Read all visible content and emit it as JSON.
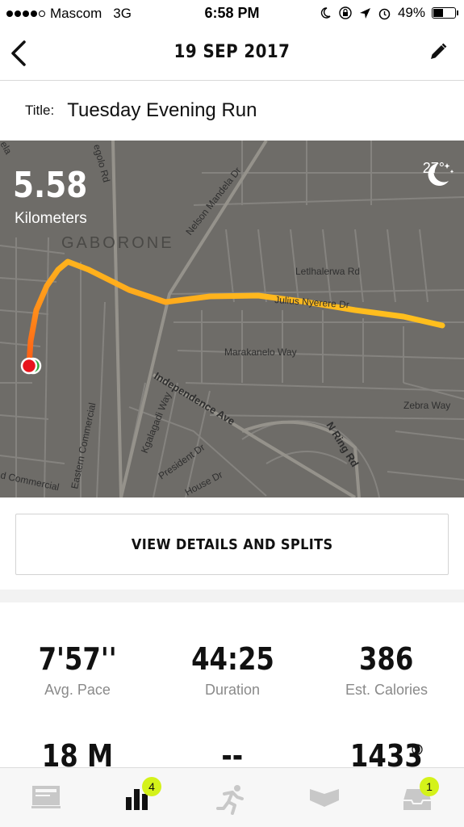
{
  "status_bar": {
    "carrier": "Mascom",
    "network": "3G",
    "time": "6:58 PM",
    "battery_percent": "49%",
    "battery_level": 0.49
  },
  "header": {
    "title": "19 SEP 2017",
    "back_icon": "chevron-left-icon",
    "edit_icon": "pencil-icon"
  },
  "run_title": {
    "label": "Title:",
    "value": "Tuesday Evening Run"
  },
  "map": {
    "distance": "5.58",
    "distance_unit": "Kilometers",
    "temperature": "27°",
    "weather_icon": "moon-stars-icon",
    "labels": {
      "city": "GABORONE",
      "nelson": "Nelson Mandela Dr",
      "letlhalerwa": "Letlhalerwa Rd",
      "julius": "Julius Nyerere Dr",
      "marakanelo": "Marakanelo Way",
      "independence": "Independence Ave",
      "nring": "N Ring Rd",
      "zebra": "Zebra Way",
      "kgalagadi": "Kgalagadi Way",
      "president": "President Dr",
      "house": "House Dr",
      "eastern": "Eastern Commercial",
      "commercial": "d Commercial",
      "segolo": "egolo Rd",
      "ela": "ela"
    },
    "route_colors": [
      "#ff6a1a",
      "#ffb21a",
      "#ffd21a"
    ]
  },
  "details_button": {
    "label": "VIEW DETAILS AND SPLITS"
  },
  "stats": [
    {
      "value": "7'57''",
      "label": "Avg. Pace"
    },
    {
      "value": "44:25",
      "label": "Duration"
    },
    {
      "value": "386",
      "label": "Est. Calories"
    },
    {
      "value": "18 M",
      "label": ""
    },
    {
      "value": "--",
      "label": ""
    },
    {
      "value": "1433",
      "label": ""
    }
  ],
  "tab_bar": {
    "tabs": [
      {
        "icon": "feed-icon"
      },
      {
        "icon": "activity-bars-icon",
        "badge": "4"
      },
      {
        "icon": "runner-icon"
      },
      {
        "icon": "club-icon"
      },
      {
        "icon": "inbox-icon",
        "badge": "1"
      }
    ]
  },
  "colors": {
    "accent": "#d4f21a",
    "map_bg": "#6e6c68"
  }
}
